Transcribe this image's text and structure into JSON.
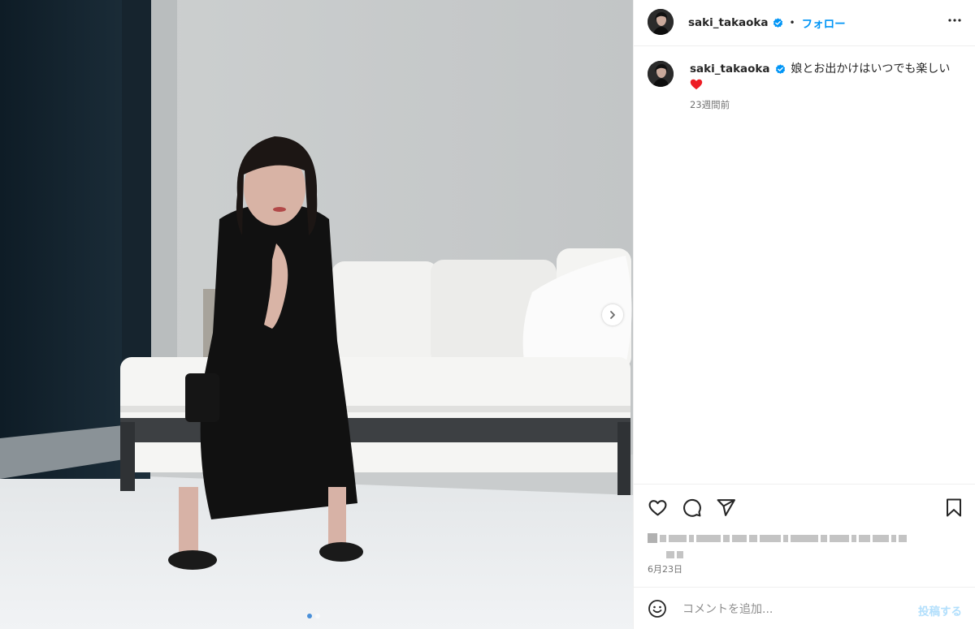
{
  "post": {
    "username": "saki_takaoka",
    "follow_label": "フォロー",
    "separator": "•",
    "caption": "娘とお出かけはいつでも楽しい",
    "caption_emoji": "heart-emoji",
    "time_ago": "23週間前",
    "date": "6月23日"
  },
  "comment": {
    "placeholder": "コメントを追加...",
    "post_label": "投稿する"
  },
  "carousel": {
    "slide_count": 2,
    "active_index": 0
  },
  "colors": {
    "accent": "#0095f6",
    "verified": "#0095f6",
    "heart": "#ed1c24",
    "post_disabled": "#b2dffc"
  }
}
